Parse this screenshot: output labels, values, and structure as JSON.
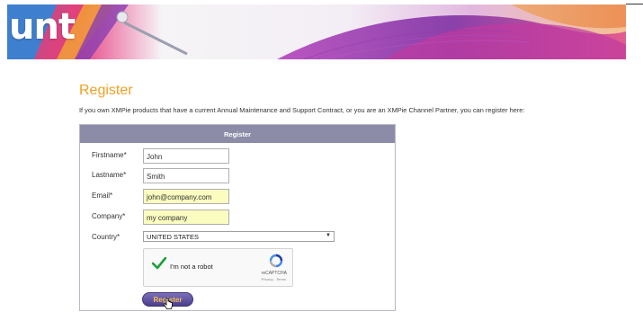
{
  "banner": {
    "title": "unt"
  },
  "page": {
    "title": "Register",
    "intro": "If you own XMPie products that have a current Annual Maintenance and Support Contract, or you are an XMPie Channel Partner, you can register here:"
  },
  "form": {
    "header": "Register",
    "fields": {
      "firstname": {
        "label": "Firstname*",
        "value": "John"
      },
      "lastname": {
        "label": "Lastname*",
        "value": "Smith"
      },
      "email": {
        "label": "Email*",
        "value": "john@company.com"
      },
      "company": {
        "label": "Company*",
        "value": "my company"
      },
      "country": {
        "label": "Country*",
        "value": "UNITED STATES"
      }
    },
    "recaptcha": {
      "label": "I'm not a robot",
      "brand": "reCAPTCHA",
      "terms": "Privacy - Terms"
    },
    "submit_label": "Register"
  },
  "colors": {
    "accent": "#f0a020",
    "header_bg": "#8c8ca8",
    "autofill_bg": "#fafcc0",
    "button_bg": "#5b4f9e",
    "button_text": "#f7c05a"
  }
}
